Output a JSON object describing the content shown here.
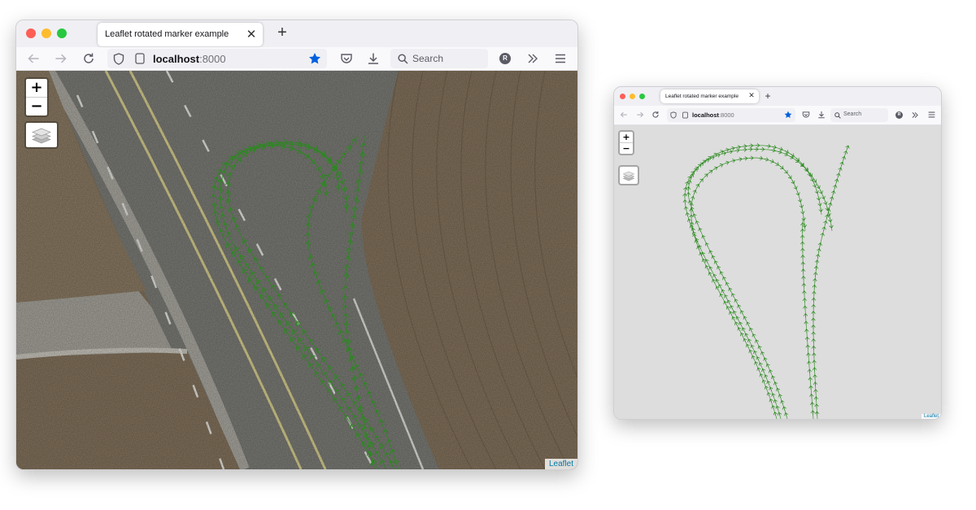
{
  "windows": [
    {
      "id": "big",
      "tab": {
        "title": "Leaflet rotated marker example",
        "close": "✕"
      },
      "new_tab": "+",
      "url": {
        "host": "localhost",
        "port": ":8000"
      },
      "search": {
        "placeholder": "Search"
      },
      "account_initial": "R",
      "map": {
        "background": "aerial imagery",
        "zoom_in": "+",
        "zoom_out": "−",
        "attribution": "Leaflet"
      }
    },
    {
      "id": "small",
      "tab": {
        "title": "Leaflet rotated marker example",
        "close": "✕"
      },
      "new_tab": "+",
      "url": {
        "host": "localhost",
        "port": ":8000"
      },
      "search": {
        "placeholder": "Search"
      },
      "account_initial": "R",
      "map": {
        "background": "plain gray",
        "zoom_in": "+",
        "zoom_out": "−",
        "attribution": "Leaflet"
      }
    }
  ],
  "colors": {
    "track": "#2a8a1e",
    "bookmark_star": "#0060df",
    "asphalt": "#7b7b76",
    "field": "#83725c",
    "lane_yellow": "#d8cf8d",
    "attribution": "#0078a8"
  },
  "icons": [
    "back-arrow-icon",
    "forward-arrow-icon",
    "reload-icon",
    "shield-icon",
    "page-icon",
    "star-icon",
    "pocket-icon",
    "download-icon",
    "search-icon",
    "overflow-chevrons-icon",
    "hamburger-menu-icon",
    "layers-icon",
    "arrow-marker-icon"
  ]
}
